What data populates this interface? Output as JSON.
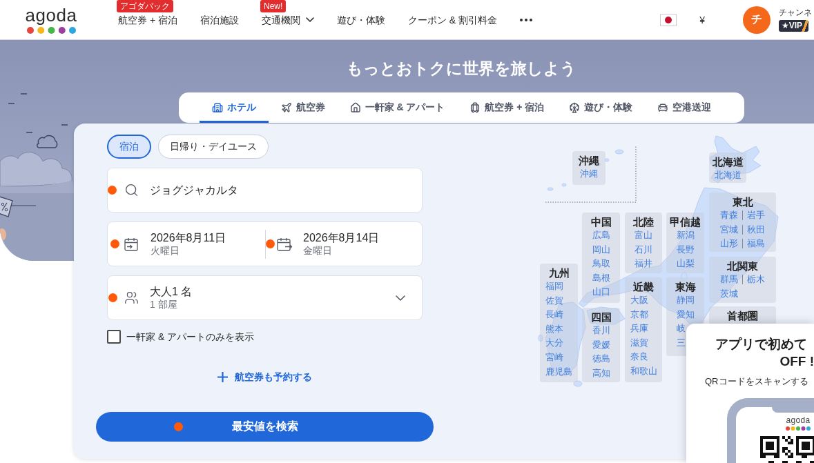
{
  "header": {
    "logo": "agoda",
    "nav": [
      {
        "kind": "link",
        "label": "航空券 + 宿泊",
        "badge": "アゴダパック",
        "dropdown": false
      },
      {
        "kind": "link",
        "label": "宿泊施設",
        "dropdown": false
      },
      {
        "kind": "link",
        "label": "交通機関",
        "badge": "New!",
        "dropdown": true
      },
      {
        "kind": "link",
        "label": "遊び・体験",
        "dropdown": false
      },
      {
        "kind": "link",
        "label": "クーポン & 割引料金",
        "dropdown": false
      },
      {
        "kind": "more"
      }
    ],
    "currency": "¥",
    "account": {
      "initial": "チ",
      "name": "チャンネ",
      "tier": "★VIP"
    }
  },
  "hero": {
    "title": "もっとおトクに世界を旅しよう"
  },
  "product_tabs": [
    {
      "kind": "hotel",
      "label": "ホテル",
      "selected": true
    },
    {
      "kind": "flight",
      "label": "航空券",
      "selected": false
    },
    {
      "kind": "home",
      "label": "一軒家 & アパート",
      "selected": false
    },
    {
      "kind": "package",
      "label": "航空券 + 宿泊",
      "selected": false
    },
    {
      "kind": "activity",
      "label": "遊び・体験",
      "selected": false
    },
    {
      "kind": "transfer",
      "label": "空港送迎",
      "selected": false
    }
  ],
  "search": {
    "stay_types": [
      {
        "label": "宿泊",
        "selected": true
      },
      {
        "label": "日帰り・デイユース",
        "selected": false
      }
    ],
    "destination": {
      "value": "ジョグジャカルタ"
    },
    "check_in": {
      "date": "2026年8月11日",
      "weekday": "火曜日"
    },
    "check_out": {
      "date": "2026年8月14日",
      "weekday": "金曜日"
    },
    "guests": {
      "summary": "大人1 名",
      "rooms": "1 部屋"
    },
    "homes_only": {
      "label": "一軒家 & アパートのみを表示",
      "checked": false
    },
    "add_flight": "航空券も予約する",
    "submit": "最安値を検索"
  },
  "map": {
    "regions": [
      {
        "name": "沖縄",
        "rows": [
          [
            "沖縄"
          ]
        ]
      },
      {
        "name": "北海道",
        "rows": [
          [
            "北海道"
          ]
        ]
      },
      {
        "name": "東北",
        "rows": [
          [
            "青森",
            "岩手"
          ],
          [
            "宮城",
            "秋田"
          ],
          [
            "山形",
            "福島"
          ]
        ]
      },
      {
        "name": "中国",
        "rows": [
          [
            "広島"
          ],
          [
            "岡山"
          ],
          [
            "鳥取"
          ],
          [
            "島根"
          ],
          [
            "山口"
          ]
        ]
      },
      {
        "name": "北陸",
        "rows": [
          [
            "富山"
          ],
          [
            "石川"
          ],
          [
            "福井"
          ]
        ]
      },
      {
        "name": "甲信越",
        "rows": [
          [
            "新潟"
          ],
          [
            "長野"
          ],
          [
            "山梨"
          ]
        ]
      },
      {
        "name": "九州",
        "rows": [
          [
            "福岡"
          ],
          [
            "佐賀"
          ],
          [
            "長崎"
          ],
          [
            "熊本"
          ],
          [
            "大分"
          ],
          [
            "宮崎"
          ],
          [
            "鹿児島"
          ]
        ]
      },
      {
        "name": "北関東",
        "rows": [
          [
            "群馬",
            "栃木"
          ],
          [
            "茨城"
          ]
        ]
      },
      {
        "name": "近畿",
        "rows": [
          [
            "大阪"
          ],
          [
            "京都"
          ],
          [
            "兵庫"
          ],
          [
            "滋賀"
          ],
          [
            "奈良"
          ],
          [
            "和歌山"
          ]
        ]
      },
      {
        "name": "東海",
        "rows": [
          [
            "静岡"
          ],
          [
            "愛知"
          ],
          [
            "岐"
          ],
          [
            "三"
          ]
        ]
      },
      {
        "name": "四国",
        "rows": [
          [
            "香川"
          ],
          [
            "愛媛"
          ],
          [
            "徳島"
          ],
          [
            "高知"
          ]
        ]
      },
      {
        "name": "首都圏"
      }
    ]
  },
  "app_promo": {
    "title_lines": [
      "アプリで初めて",
      "OFF !"
    ],
    "text": "QRコードをスキャンする",
    "phone_logo": "agoda"
  }
}
